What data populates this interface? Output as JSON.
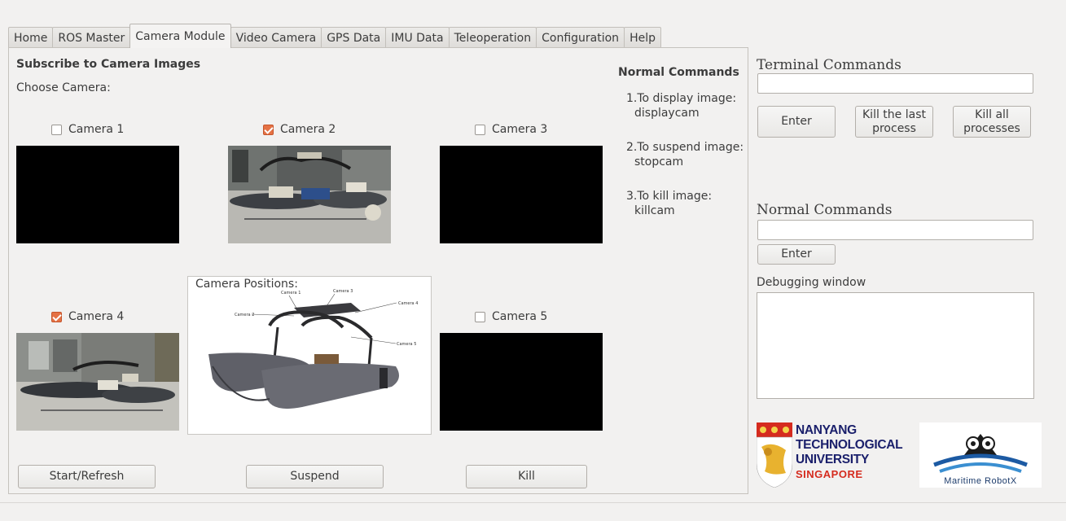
{
  "tabs": [
    "Home",
    "ROS Master",
    "Camera Module",
    "Video Camera",
    "GPS Data",
    "IMU Data",
    "Teleoperation",
    "Configuration",
    "Help"
  ],
  "active_tab": "Camera Module",
  "camera_panel": {
    "title": "Subscribe to Camera Images",
    "choose_label": "Choose Camera:",
    "cameras": [
      {
        "label": "Camera 1",
        "checked": false
      },
      {
        "label": "Camera 2",
        "checked": true
      },
      {
        "label": "Camera 3",
        "checked": false
      },
      {
        "label": "Camera 4",
        "checked": true
      },
      {
        "label": "Camera 5",
        "checked": false
      }
    ],
    "positions_label": "Camera Positions:",
    "diagram_labels": {
      "c1": "Camera 1",
      "c2": "Camera 2",
      "c3": "Camera 3",
      "c4": "Camera 4",
      "c5": "Camera 5"
    },
    "buttons": {
      "start": "Start/Refresh",
      "suspend": "Suspend",
      "kill": "Kill"
    }
  },
  "normal_commands_help": {
    "title": "Normal Commands",
    "items": [
      {
        "line1": "1.To display image:",
        "line2": "displaycam"
      },
      {
        "line1": "2.To suspend image:",
        "line2": "stopcam"
      },
      {
        "line1": "3.To kill image:",
        "line2": "killcam"
      }
    ]
  },
  "terminal": {
    "title": "Terminal Commands",
    "input_value": "",
    "enter": "Enter",
    "kill_last": [
      "Kill the last",
      "process"
    ],
    "kill_all": [
      "Kill all",
      "processes"
    ]
  },
  "normal_commands": {
    "title": "Normal Commands",
    "input_value": "",
    "enter": "Enter"
  },
  "debug": {
    "title": "Debugging window",
    "content": ""
  },
  "logos": {
    "ntu": [
      "NANYANG",
      "TECHNOLOGICAL",
      "UNIVERSITY",
      "SINGAPORE"
    ],
    "robotx": "Maritime RobotX"
  },
  "colors": {
    "checkbox_accent": "#e57245",
    "ntu_red": "#d52b1e",
    "ntu_blue": "#1a1f6b",
    "robotx_blue": "#1c5aa3"
  }
}
